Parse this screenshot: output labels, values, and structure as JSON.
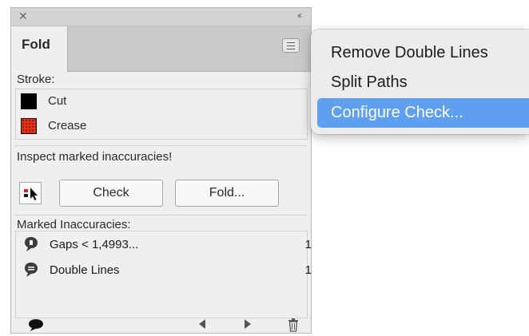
{
  "panel": {
    "tab_label": "Fold",
    "stroke_label": "Stroke:",
    "strokes": [
      {
        "label": "Cut",
        "color": "#000000"
      },
      {
        "label": "Crease",
        "color": "#e23214"
      }
    ],
    "inspect_label": "Inspect marked inaccuracies!",
    "check_button": "Check",
    "fold_button": "Fold...",
    "marked_label": "Marked Inaccuracies:",
    "inaccuracies": [
      {
        "label": "Gaps < 1,4993...",
        "count": "1",
        "icon": "comment-marker-icon"
      },
      {
        "label": "Double Lines",
        "count": "1",
        "icon": "comment-marker-icon"
      }
    ]
  },
  "menu": {
    "items": [
      {
        "label": "Remove Double Lines",
        "highlighted": false
      },
      {
        "label": "Split Paths",
        "highlighted": false
      },
      {
        "label": "Configure Check...",
        "highlighted": true
      }
    ],
    "highlight_color": "#5e9ff0"
  }
}
